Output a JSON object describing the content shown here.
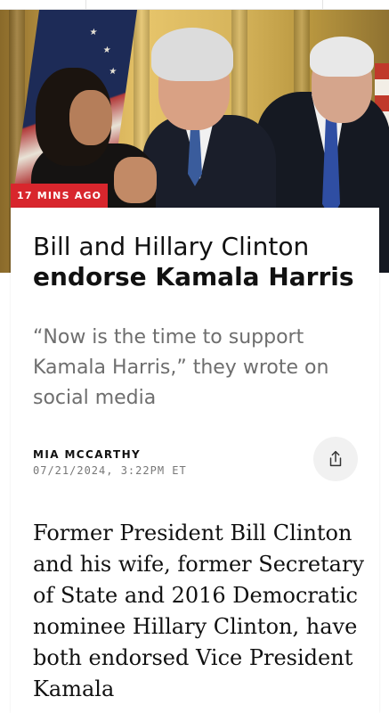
{
  "article": {
    "time_badge": "17 MINS AGO",
    "headline_line1": "Bill and Hillary Clinton",
    "headline_line2": "endorse Kamala Harris",
    "dek": "“Now is the time to support Kamala Harris,” they wrote on social media",
    "author": "MIA MCCARTHY",
    "date": "07/21/2024, 3:22PM ET",
    "body": "Former President Bill Clinton and his wife, former Secretary of State and 2016 Democratic nominee Hillary Clinton, have both endorsed Vice President Kamala"
  },
  "icons": {
    "share": "share-icon"
  },
  "colors": {
    "badge_bg": "#d8262d",
    "headline": "#111111",
    "dek": "#6e6e6e",
    "meta": "#777777",
    "share_bg": "#f1f1f1"
  }
}
